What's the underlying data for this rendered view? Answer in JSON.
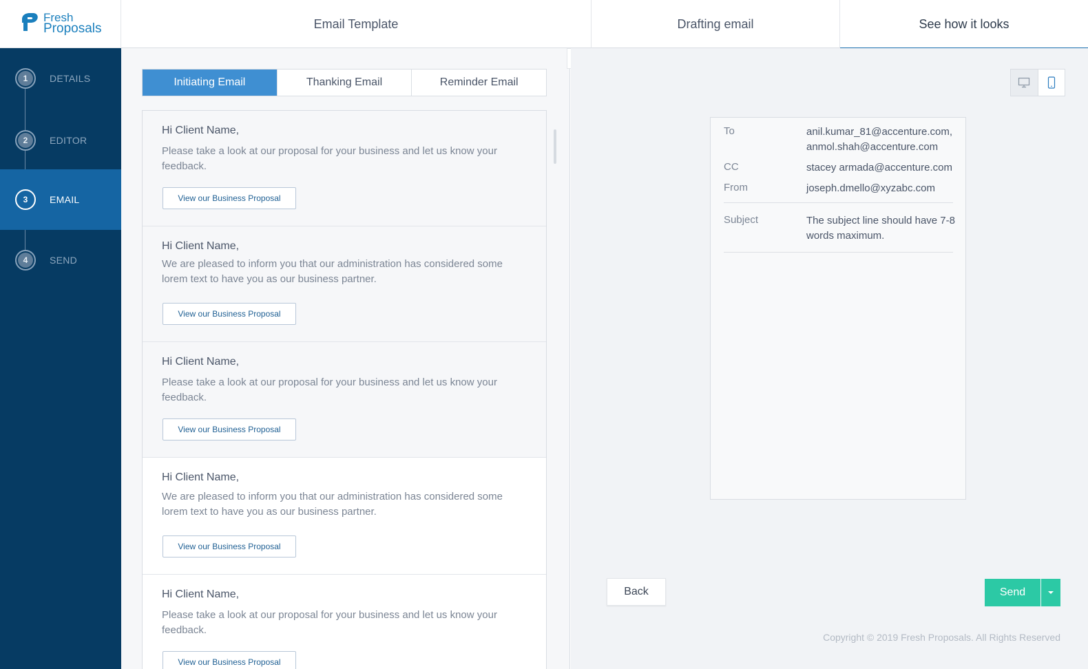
{
  "brand": {
    "name_line1": "Fresh",
    "name_line2": "Proposals",
    "color": "#1a7fbd"
  },
  "top_tabs": [
    {
      "label": "Email Template"
    },
    {
      "label": "Drafting email"
    },
    {
      "label": "See how it looks",
      "active": true
    }
  ],
  "sidebar": {
    "steps": [
      {
        "num": "1",
        "label": "DETAILS"
      },
      {
        "num": "2",
        "label": "EDITOR"
      },
      {
        "num": "3",
        "label": "EMAIL",
        "active": true
      },
      {
        "num": "4",
        "label": "SEND"
      }
    ]
  },
  "email_tabs": [
    {
      "label": "Initiating Email",
      "active": true
    },
    {
      "label": "Thanking Email"
    },
    {
      "label": "Reminder Email"
    }
  ],
  "templates": [
    {
      "greeting": "Hi Client Name,",
      "body": "Please take a look at our proposal for your business and let us know your feedback.",
      "button": "View our Business Proposal"
    },
    {
      "greeting": "Hi Client Name,",
      "body": "We are pleased to inform you that our administration has considered some lorem text to have you as our business partner.",
      "button": "View our Business Proposal"
    },
    {
      "greeting": "Hi Client Name,",
      "body": "Please take a look at our proposal for your business and let us know your feedback.",
      "button": "View our Business Proposal"
    },
    {
      "greeting": "Hi Client Name,",
      "body": "We are pleased to inform you that our administration has considered some lorem text to have you as our business partner.",
      "button": "View our Business Proposal"
    },
    {
      "greeting": "Hi Client Name,",
      "body": "Please take a look at our proposal for your business and let us know your feedback.",
      "button": "View our Business Proposal"
    }
  ],
  "preview": {
    "to_label": "To",
    "to_value": "anil.kumar_81@accenture.com, anmol.shah@accenture.com",
    "cc_label": "CC",
    "cc_value": "stacey armada@accenture.com",
    "from_label": "From",
    "from_value": "joseph.dmello@xyzabc.com",
    "subject_label": "Subject",
    "subject_value": "The subject line should have 7-8 words maximum."
  },
  "actions": {
    "back": "Back",
    "send": "Send"
  },
  "footer": {
    "copyright": "Copyright © 2019 Fresh Proposals. All Rights Reserved"
  },
  "colors": {
    "sidebar": "#063b63",
    "active_step": "#1565a3",
    "active_tab": "#3f8fd2",
    "send": "#2cc9a5"
  }
}
